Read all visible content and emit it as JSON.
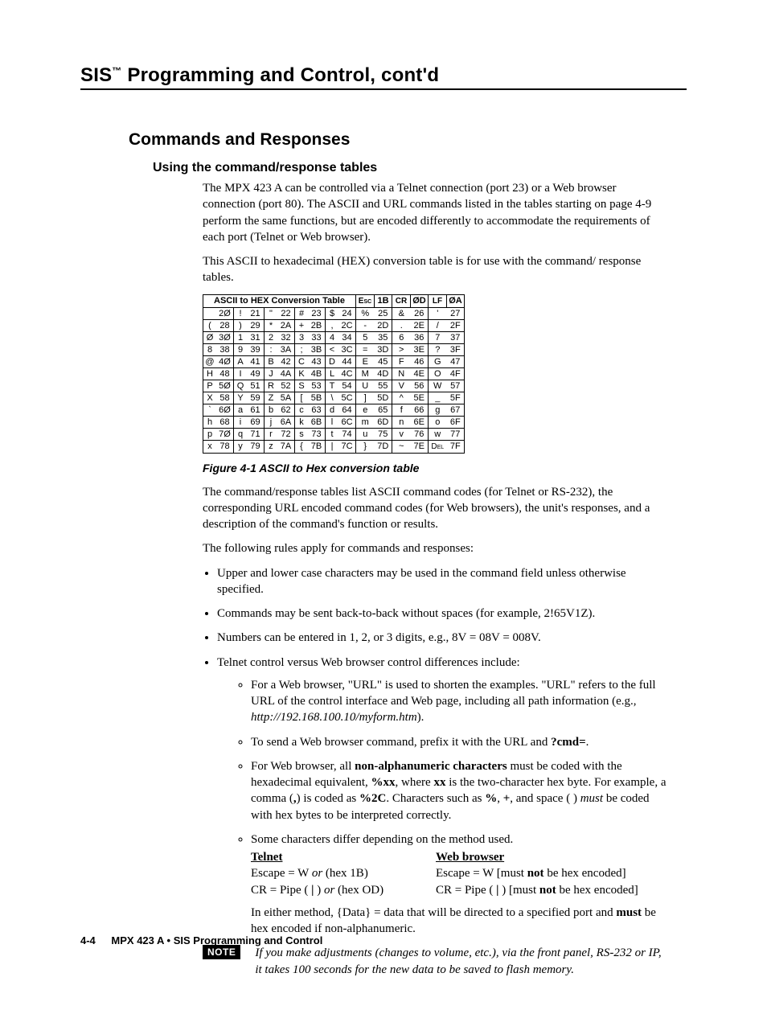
{
  "header": {
    "prefix": "SIS",
    "tm": "™",
    "suffix": " Programming and Control, cont'd"
  },
  "h1": "Commands and Responses",
  "h2": "Using the command/response tables",
  "para1": "The MPX 423 A can be controlled via a Telnet connection (port 23) or a Web browser connection (port 80).  The ASCII and URL commands listed in the tables starting on page 4-9 perform the same functions, but are encoded differently to accommodate the requirements of each port (Telnet or Web browser).",
  "para2": "This ASCII to hexadecimal (HEX) conversion table is for use with the command/ response tables.",
  "table": {
    "title": "ASCII to HEX  Conversion Table",
    "special": [
      [
        "Esc",
        "1B"
      ],
      [
        "CR",
        "ØD"
      ],
      [
        "LF",
        "ØA"
      ]
    ],
    "rows": [
      [
        [
          " ",
          "2Ø"
        ],
        [
          "!",
          "21"
        ],
        [
          "\"",
          "22"
        ],
        [
          "#",
          "23"
        ],
        [
          "$",
          "24"
        ],
        [
          "%",
          "25"
        ],
        [
          "&",
          "26"
        ],
        [
          "'",
          "27"
        ]
      ],
      [
        [
          "(",
          "28"
        ],
        [
          ")",
          "29"
        ],
        [
          "*",
          "2A"
        ],
        [
          "+",
          "2B"
        ],
        [
          ",",
          "2C"
        ],
        [
          "-",
          "2D"
        ],
        [
          ".",
          "2E"
        ],
        [
          "/",
          "2F"
        ]
      ],
      [
        [
          "Ø",
          "3Ø"
        ],
        [
          "1",
          "31"
        ],
        [
          "2",
          "32"
        ],
        [
          "3",
          "33"
        ],
        [
          "4",
          "34"
        ],
        [
          "5",
          "35"
        ],
        [
          "6",
          "36"
        ],
        [
          "7",
          "37"
        ]
      ],
      [
        [
          "8",
          "38"
        ],
        [
          "9",
          "39"
        ],
        [
          ":",
          "3A"
        ],
        [
          ";",
          "3B"
        ],
        [
          "<",
          "3C"
        ],
        [
          "=",
          "3D"
        ],
        [
          ">",
          "3E"
        ],
        [
          "?",
          "3F"
        ]
      ],
      [
        [
          "@",
          "4Ø"
        ],
        [
          "A",
          "41"
        ],
        [
          "B",
          "42"
        ],
        [
          "C",
          "43"
        ],
        [
          "D",
          "44"
        ],
        [
          "E",
          "45"
        ],
        [
          "F",
          "46"
        ],
        [
          "G",
          "47"
        ]
      ],
      [
        [
          "H",
          "48"
        ],
        [
          "I",
          "49"
        ],
        [
          "J",
          "4A"
        ],
        [
          "K",
          "4B"
        ],
        [
          "L",
          "4C"
        ],
        [
          "M",
          "4D"
        ],
        [
          "N",
          "4E"
        ],
        [
          "O",
          "4F"
        ]
      ],
      [
        [
          "P",
          "5Ø"
        ],
        [
          "Q",
          "51"
        ],
        [
          "R",
          "52"
        ],
        [
          "S",
          "53"
        ],
        [
          "T",
          "54"
        ],
        [
          "U",
          "55"
        ],
        [
          "V",
          "56"
        ],
        [
          "W",
          "57"
        ]
      ],
      [
        [
          "X",
          "58"
        ],
        [
          "Y",
          "59"
        ],
        [
          "Z",
          "5A"
        ],
        [
          "[",
          "5B"
        ],
        [
          "\\",
          "5C"
        ],
        [
          "]",
          "5D"
        ],
        [
          "^",
          "5E"
        ],
        [
          "_",
          "5F"
        ]
      ],
      [
        [
          "`",
          "6Ø"
        ],
        [
          "a",
          "61"
        ],
        [
          "b",
          "62"
        ],
        [
          "c",
          "63"
        ],
        [
          "d",
          "64"
        ],
        [
          "e",
          "65"
        ],
        [
          "f",
          "66"
        ],
        [
          "g",
          "67"
        ]
      ],
      [
        [
          "h",
          "68"
        ],
        [
          "i",
          "69"
        ],
        [
          "j",
          "6A"
        ],
        [
          "k",
          "6B"
        ],
        [
          "l",
          "6C"
        ],
        [
          "m",
          "6D"
        ],
        [
          "n",
          "6E"
        ],
        [
          "o",
          "6F"
        ]
      ],
      [
        [
          "p",
          "7Ø"
        ],
        [
          "q",
          "71"
        ],
        [
          "r",
          "72"
        ],
        [
          "s",
          "73"
        ],
        [
          "t",
          "74"
        ],
        [
          "u",
          "75"
        ],
        [
          "v",
          "76"
        ],
        [
          "w",
          "77"
        ]
      ],
      [
        [
          "x",
          "78"
        ],
        [
          "y",
          "79"
        ],
        [
          "z",
          "7A"
        ],
        [
          "{",
          "7B"
        ],
        [
          "|",
          "7C"
        ],
        [
          "}",
          "7D"
        ],
        [
          "~",
          "7E"
        ],
        [
          "DEL",
          "7F"
        ]
      ]
    ]
  },
  "figcaption": "Figure 4-1 ASCII to Hex conversion table",
  "para3": "The command/response tables list ASCII command codes (for Telnet or RS-232), the corresponding URL encoded command codes (for Web browsers), the unit's responses, and a description of the command's function or results.",
  "para4": "The following rules apply for commands and responses:",
  "bullets": {
    "b1": "Upper and lower case characters may be used in the command field unless otherwise specified.",
    "b2": "Commands may be sent back-to-back without spaces (for example, 2!65V1Z).",
    "b3": "Numbers can be entered in 1, 2, or 3 digits, e.g., 8V = 08V = 008V.",
    "b4": "Telnet control versus Web browser control differences include:"
  },
  "inner": {
    "i1a": "For a Web browser, \"URL\" is used to shorten the examples.  \"URL\" refers to the full URL of the control interface and Web page, including all path information (e.g., ",
    "i1b": "http://192.168.100.10/myform.htm",
    "i1c": ").",
    "i2a": "To send a Web browser command, prefix it with the URL and ",
    "i2b": "?cmd=",
    "i2c": ".",
    "i3a": "For Web browser, all ",
    "i3b": "non-alphanumeric characters",
    "i3c": " must be coded with the hexadecimal equivalent, ",
    "i3d": "%xx",
    "i3e": ", where ",
    "i3f": "xx",
    "i3g": " is the two-character hex byte. For example, a comma (",
    "i3h": ",",
    "i3i": ") is coded as ",
    "i3j": "%2C",
    "i3k": ".  Characters such as ",
    "i3l": "%",
    "i3m": ", ",
    "i3n": "+",
    "i3o": ", and space ( ) ",
    "i3p": "must",
    "i3q": " be coded with hex bytes to be interpreted correctly.",
    "i4": "Some characters differ depending on the method used.",
    "colA_h": "Telnet",
    "colB_h": "Web browser",
    "colA_1a": "Escape = W ",
    "colA_1b": "or",
    "colA_1c": " (hex 1B)",
    "colB_1a": "Escape = W [must ",
    "colB_1b": "not",
    "colB_1c": " be hex encoded]",
    "colA_2a": "CR = Pipe ( ",
    "colA_2b": "|",
    "colA_2c": " ) ",
    "colA_2d": "or",
    "colA_2e": " (hex OD)",
    "colB_2a": "CR = Pipe ( ",
    "colB_2b": "|",
    "colB_2c": " ) [must ",
    "colB_2d": "not",
    "colB_2e": " be hex encoded]",
    "tail1": "In either method, {Data} = data that will be directed to a specified port and ",
    "tail2": "must",
    "tail3": " be hex encoded if non-alphanumeric."
  },
  "note": {
    "badge": "NOTE",
    "text": "If you make adjustments (changes to volume, etc.), via the front panel, RS-232 or IP, it takes 100 seconds for the new data to be saved to flash memory."
  },
  "footer": {
    "page": "4-4",
    "text": "MPX 423 A • SIS Programming and Control"
  }
}
